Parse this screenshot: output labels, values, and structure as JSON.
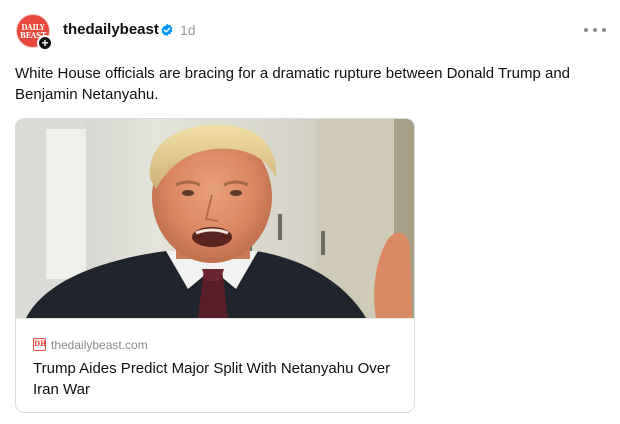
{
  "post": {
    "author": {
      "username": "thedailybeast",
      "avatar_logo_text": "DAILY BEAST",
      "verified": true,
      "follow_badge": "+"
    },
    "timestamp": "1d",
    "more_icon": "more-horizontal-icon",
    "caption": "White House officials are bracing for a dramatic rupture between Donald Trump and Benjamin Netanyahu.",
    "link_card": {
      "image_subject": "photo of Donald Trump speaking",
      "source_icon_text": "DB",
      "domain": "thedailybeast.com",
      "title": "Trump Aides Predict Major Split With Netanyahu Over Iran War"
    }
  },
  "colors": {
    "brand_red": "#e8473b",
    "verified_blue": "#0095f6",
    "muted_text": "#999999",
    "card_border": "#dcdcdc"
  }
}
